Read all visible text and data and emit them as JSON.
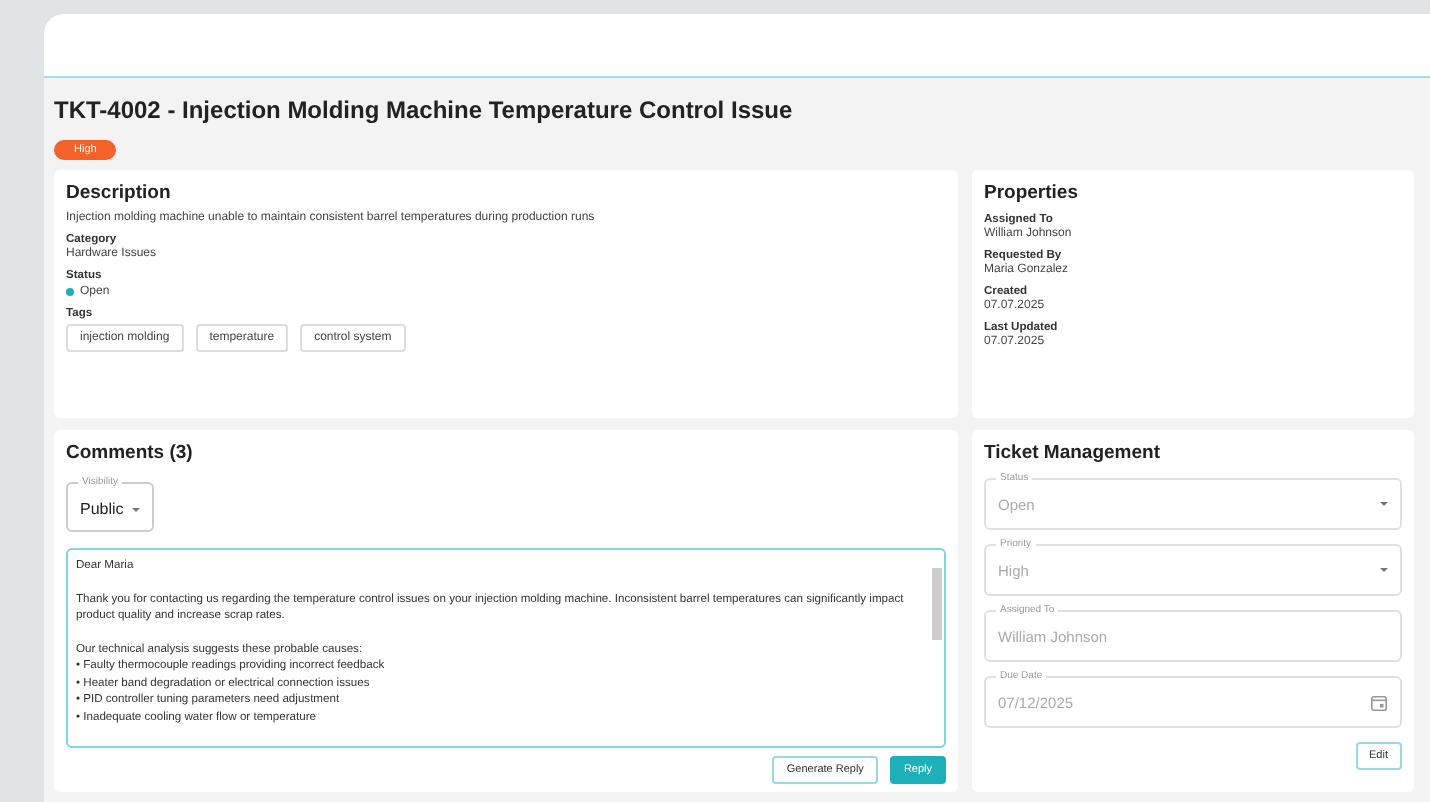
{
  "ticket": {
    "title": "TKT-4002 - Injection Molding Machine Temperature Control Issue",
    "priority_badge": "High"
  },
  "description": {
    "heading": "Description",
    "text": "Injection molding machine unable to maintain consistent barrel temperatures during production runs",
    "fields": [
      {
        "label": "Category",
        "value": "Hardware Issues",
        "kind": "text"
      },
      {
        "label": "Status",
        "value": "Open",
        "kind": "status"
      }
    ],
    "tags_label": "Tags",
    "tags": [
      "injection molding",
      "temperature",
      "control system"
    ]
  },
  "properties": {
    "heading": "Properties",
    "items": [
      {
        "label": "Assigned To",
        "value": "William Johnson"
      },
      {
        "label": "Requested By",
        "value": "Maria Gonzalez"
      },
      {
        "label": "Created",
        "value": "07.07.2025"
      },
      {
        "label": "Last Updated",
        "value": "07.07.2025"
      }
    ]
  },
  "comments": {
    "heading": "Comments (3)",
    "visibility": {
      "label": "Visibility",
      "value": "Public"
    },
    "reply_text": "Dear Maria\n\nThank you for contacting us regarding the temperature control issues on your injection molding machine. Inconsistent barrel temperatures can significantly impact product quality and increase scrap rates.\n\nOur technical analysis suggests these probable causes:\n• Faulty thermocouple readings providing incorrect feedback\n• Heater band degradation or electrical connection issues\n• PID controller tuning parameters need adjustment\n• Inadequate cooling water flow or temperature",
    "buttons": [
      {
        "label": "Generate Reply",
        "kind": "outlined"
      },
      {
        "label": "Reply",
        "kind": "primary"
      }
    ]
  },
  "ticket_management": {
    "heading": "Ticket Management",
    "fields": [
      {
        "label": "Status",
        "value": "Open",
        "kind": "select",
        "disabled": true
      },
      {
        "label": "Priority",
        "value": "High",
        "kind": "select",
        "disabled": true
      },
      {
        "label": "Assigned To",
        "value": "William Johnson",
        "kind": "text",
        "disabled": true
      },
      {
        "label": "Due Date",
        "value": "07/12/2025",
        "kind": "date",
        "disabled": true
      }
    ],
    "edit_button": "Edit"
  }
}
